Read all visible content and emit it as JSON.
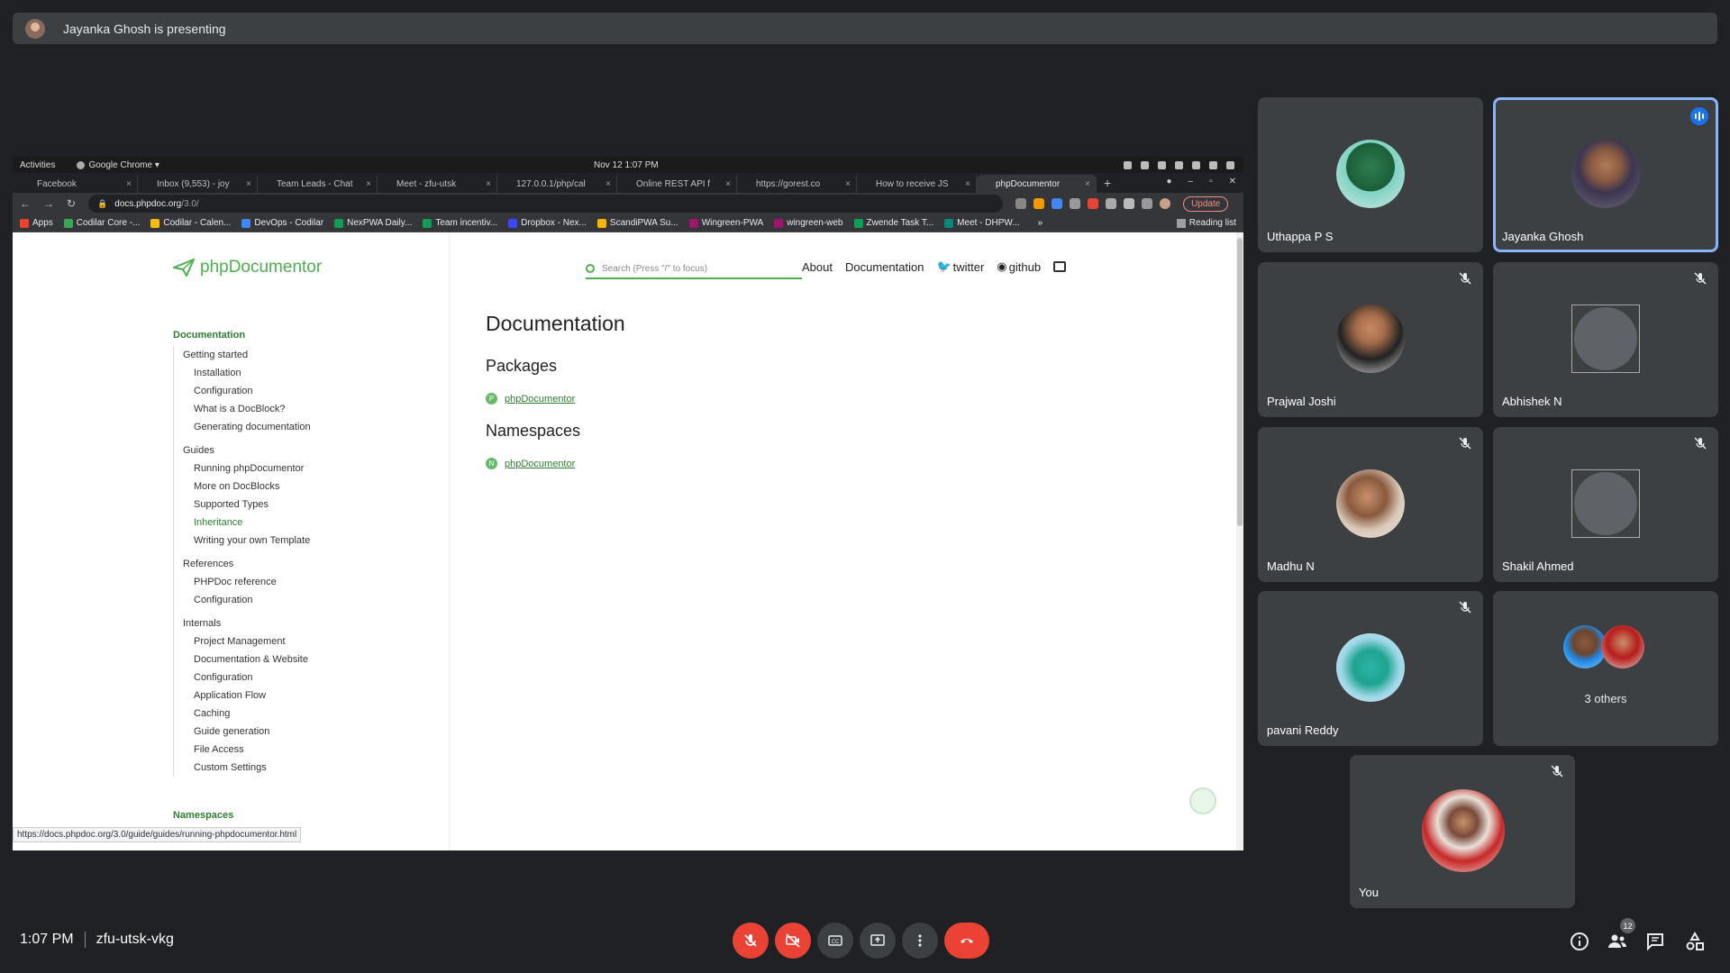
{
  "presenting_banner": {
    "text": "Jayanka Ghosh is presenting"
  },
  "os_bar": {
    "activities": "Activities",
    "app": "Google Chrome ▾",
    "clock": "Nov 12   1:07 PM"
  },
  "tabs": [
    {
      "label": "Facebook",
      "color": "#1877f2"
    },
    {
      "label": "Inbox (9,553) - joy",
      "color": "#ea4335"
    },
    {
      "label": "Team Leads - Chat",
      "color": "#34a853"
    },
    {
      "label": "Meet - zfu-utsk",
      "color": "#00897b"
    },
    {
      "label": "127.0.0.1/php/cal",
      "color": "#9aa0a6"
    },
    {
      "label": "Online REST API f",
      "color": "#e8453c"
    },
    {
      "label": "https://gorest.co",
      "color": "#e8453c"
    },
    {
      "label": "How to receive JS",
      "color": "#34a853"
    },
    {
      "label": "phpDocumentor",
      "color": "#9aa0a6",
      "active": true
    }
  ],
  "address_bar": {
    "domain": "docs.phpdoc.org",
    "path": "/3.0/",
    "update_label": "Update"
  },
  "bookmarks": [
    {
      "label": "Apps",
      "color": "#ea4335"
    },
    {
      "label": "Codilar Core -...",
      "color": "#34a853"
    },
    {
      "label": "Codilar - Calen...",
      "color": "#fbbc04"
    },
    {
      "label": "DevOps - Codilar",
      "color": "#4285f4"
    },
    {
      "label": "NexPWA Daily...",
      "color": "#0f9d58"
    },
    {
      "label": "Team incentiv...",
      "color": "#0f9d58"
    },
    {
      "label": "Dropbox - Nex...",
      "color": "#3d46ff"
    },
    {
      "label": "ScandiPWA Su...",
      "color": "#f4b400"
    },
    {
      "label": "Wingreen-PWA",
      "color": "#a0156b"
    },
    {
      "label": "wingreen-web",
      "color": "#a0156b"
    },
    {
      "label": "Zwende Task T...",
      "color": "#0f9d58"
    },
    {
      "label": "Meet - DHPW...",
      "color": "#00897b"
    }
  ],
  "bookmarks_more": "»",
  "reading_list": "Reading list",
  "site": {
    "logo": "phpDocumentor",
    "search_placeholder": "Search (Press \"/\" to focus)",
    "nav": {
      "about": "About",
      "documentation": "Documentation",
      "twitter": "twitter",
      "github": "github"
    },
    "sidebar_heading": "Documentation",
    "sidebar_groups": [
      {
        "label": "Getting started",
        "items": [
          "Installation",
          "Configuration",
          "What is a DocBlock?",
          "Generating documentation"
        ]
      },
      {
        "label": "Guides",
        "items": [
          "Running phpDocumentor",
          "More on DocBlocks",
          "Supported Types",
          "Inheritance",
          "Writing your own Template"
        ]
      },
      {
        "label": "References",
        "items": [
          "PHPDoc reference",
          "Configuration"
        ]
      },
      {
        "label": "Internals",
        "items": [
          "Project Management",
          "Documentation & Website",
          "Configuration",
          "Application Flow",
          "Caching",
          "Guide generation",
          "File Access",
          "Custom Settings"
        ]
      }
    ],
    "namespaces_heading": "Namespaces",
    "main_title": "Documentation",
    "packages_heading": "Packages",
    "package_badge": "P",
    "package_link": "phpDocumentor",
    "namespaces_section": "Namespaces",
    "namespace_badge": "N",
    "namespace_link": "phpDocumentor",
    "status_url": "https://docs.phpdoc.org/3.0/guide/guides/running-phpdocumentor.html"
  },
  "participants": [
    {
      "name": "Uthappa P S",
      "muted": false,
      "speaking": false
    },
    {
      "name": "Jayanka Ghosh",
      "muted": false,
      "speaking": true
    },
    {
      "name": "Prajwal Joshi",
      "muted": true
    },
    {
      "name": "Abhishek N",
      "muted": true,
      "broken_avatar": true
    },
    {
      "name": "Madhu N",
      "muted": true
    },
    {
      "name": "Shakil Ahmed",
      "muted": true,
      "broken_avatar": true
    },
    {
      "name": "pavani Reddy",
      "muted": true
    },
    {
      "name": "3 others"
    },
    {
      "name": "You",
      "muted": true
    }
  ],
  "meeting": {
    "time": "1:07 PM",
    "code": "zfu-utsk-vkg",
    "participant_count": "12"
  },
  "colors": {
    "background": "#202124",
    "tile": "#3c4043",
    "accent": "#8ab4f8",
    "danger": "#ea4335",
    "brand_green": "#4caf50"
  }
}
